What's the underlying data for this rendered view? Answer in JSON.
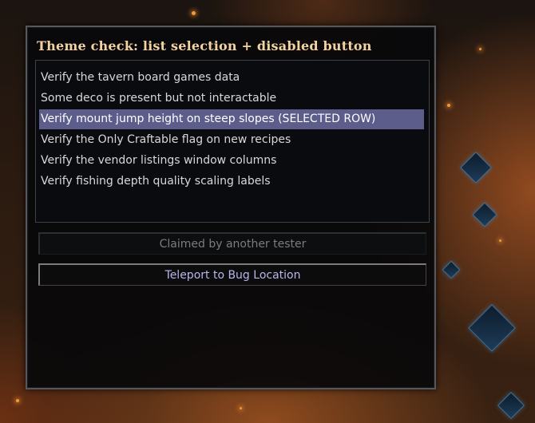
{
  "window": {
    "title": "Theme check: list selection + disabled button"
  },
  "list": {
    "items": [
      {
        "label": "Verify the tavern board games data",
        "selected": false
      },
      {
        "label": "Some deco is present but not interactable",
        "selected": false
      },
      {
        "label": "Verify mount jump height on steep slopes (SELECTED ROW)",
        "selected": true
      },
      {
        "label": "Verify the Only Craftable flag on new recipes",
        "selected": false
      },
      {
        "label": "Verify the vendor listings window columns",
        "selected": false
      },
      {
        "label": "Verify fishing depth quality scaling labels",
        "selected": false
      }
    ]
  },
  "buttons": {
    "claimed_label": "Claimed by another tester",
    "teleport_label": "Teleport to Bug Location"
  },
  "colors": {
    "title": "#f4d3a1",
    "selection": "#5c5d8a",
    "teleport_text": "#b8b6ee",
    "disabled_text": "#7c7c7c"
  }
}
